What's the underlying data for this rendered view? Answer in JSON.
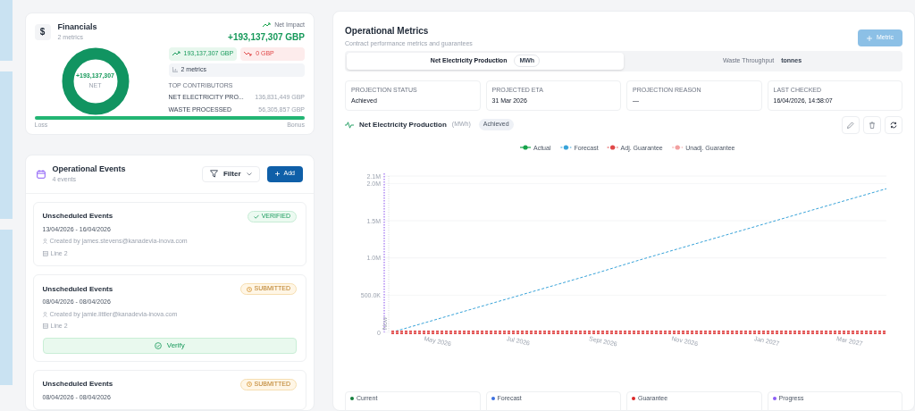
{
  "financials": {
    "icon": "$",
    "title": "Financials",
    "subtitle": "2 metrics",
    "net_label": "Net Impact",
    "net_value": "+193,137,307 GBP",
    "donut_value": "+193,137,307",
    "donut_label": "NET",
    "gain": "193,137,307 GBP",
    "loss": "0 GBP",
    "metrics_count": "2 metrics",
    "contributors_title": "TOP CONTRIBUTORS",
    "contributors": [
      {
        "name": "NET ELECTRICITY PRO...",
        "value": "136,831,449 GBP"
      },
      {
        "name": "WASTE PROCESSED",
        "value": "56,305,857 GBP"
      }
    ],
    "bar_left": "Loss",
    "bar_right": "Bonus",
    "level": 1
  },
  "events": {
    "title": "Operational Events",
    "subtitle": "4 events",
    "filter": "Filter",
    "add": "Add",
    "items": [
      {
        "title": "Unscheduled Events",
        "kind": "verified",
        "status": "VERIFIED",
        "dates": "13/04/2026 - 16/04/2026",
        "created_by": "Created by james.stevens@kanadevia-inova.com",
        "line": "Line 2"
      },
      {
        "title": "Unscheduled Events",
        "kind": "submitted",
        "status": "SUBMITTED",
        "dates": "08/04/2026 - 08/04/2026",
        "created_by": "Created by jamie.littler@kanadevia-inova.com",
        "line": "Line 2",
        "action": "Verify"
      },
      {
        "title": "Unscheduled Events",
        "kind": "submitted",
        "status": "SUBMITTED",
        "dates": "08/04/2026 - 08/04/2026"
      }
    ]
  },
  "metrics": {
    "title": "Operational Metrics",
    "subtitle": "Contract performance metrics and guarantees",
    "add_button": "Metric",
    "tabs": [
      {
        "label": "Net Electricity Production",
        "unit": "MWh",
        "selected": true
      },
      {
        "label": "Waste Throughput",
        "unit": "tonnes",
        "selected": false
      }
    ],
    "stats": [
      {
        "label": "PROJECTION STATUS",
        "value": "Achieved"
      },
      {
        "label": "PROJECTED ETA",
        "value": "31 Mar 2026"
      },
      {
        "label": "PROJECTION REASON",
        "value": "—"
      },
      {
        "label": "LAST CHECKED",
        "value": "16/04/2026, 14:58:07"
      }
    ],
    "chart_title": "Net Electricity Production",
    "chart_unit": "(MWh)",
    "chart_badge": "Achieved",
    "chart_data": {
      "type": "line",
      "grid": true,
      "legend": "top",
      "categories": [
        null,
        "May 2026",
        null,
        "Jul 2026",
        null,
        "Sept 2026",
        null,
        "Nov 2026",
        null,
        "Jan 2027",
        null,
        "Mar 2027",
        null
      ],
      "ylim": [
        0,
        2100000
      ],
      "yticks": [
        {
          "value": 0,
          "label": "0"
        },
        {
          "value": 500000,
          "label": "500.0K"
        },
        {
          "value": 1000000,
          "label": "1.0M"
        },
        {
          "value": 1500000,
          "label": "1.5M"
        },
        {
          "value": 2000000,
          "label": "2.0M"
        },
        {
          "value": 2100000,
          "label": "2.1M"
        }
      ],
      "series": [
        {
          "name": "Actual",
          "color": "#16a34a",
          "line_style": "solid",
          "values": [
            null,
            null,
            null,
            null,
            null,
            null,
            null,
            null,
            null,
            null,
            null,
            null,
            null
          ]
        },
        {
          "name": "Forecast",
          "color": "#38a3d9",
          "line_style": "dashed",
          "values": [
            0,
            160000,
            320000,
            480000,
            640000,
            800000,
            970000,
            1130000,
            1290000,
            1450000,
            1610000,
            1770000,
            1930000
          ]
        },
        {
          "name": "Adj. Guarantee",
          "color": "#e04848",
          "line_style": "dashed",
          "values": [
            0,
            0,
            0,
            0,
            0,
            0,
            0,
            0,
            0,
            0,
            0,
            0,
            0
          ]
        },
        {
          "name": "Unadj. Guarantee",
          "color": "#f2a0a0",
          "line_style": "dashed",
          "values": [
            0,
            0,
            0,
            0,
            0,
            0,
            0,
            0,
            0,
            0,
            0,
            0,
            0
          ]
        }
      ],
      "annotations": [
        "Now"
      ]
    },
    "summary_cards": [
      {
        "label": "Current",
        "color": "#15803d"
      },
      {
        "label": "Forecast",
        "color": "#3b6fe0"
      },
      {
        "label": "Guarantee",
        "color": "#dc2626"
      },
      {
        "label": "Progress",
        "color": "#8b5cf6"
      }
    ]
  }
}
